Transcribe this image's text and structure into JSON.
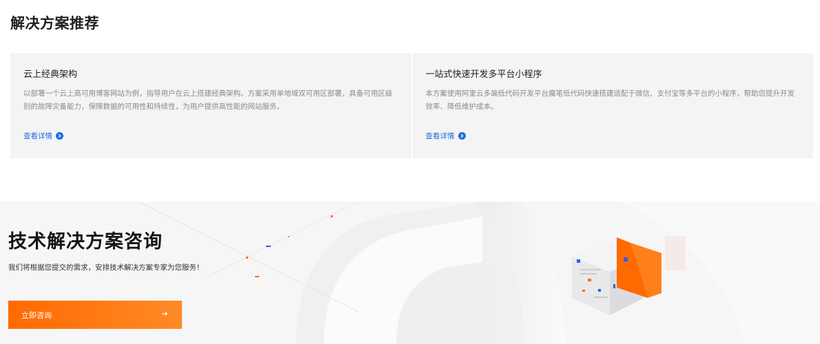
{
  "section": {
    "title": "解决方案推荐"
  },
  "cards": [
    {
      "title": "云上经典架构",
      "desc": "以部署一个云上高可用博客网站为例，指导用户在云上搭建经典架构。方案采用单地域双可用区部署，具备可用区级别的故障灾备能力，保障数据的可用性和持续性，为用户提供高性能的网站服务。",
      "link": "查看详情"
    },
    {
      "title": "一站式快速开发多平台小程序",
      "desc": "本方案使用阿里云多端低代码开发平台魔笔低代码快速搭建适配于微信、支付宝等多平台的小程序，帮助您提升开发效率、降低维护成本。",
      "link": "查看详情"
    }
  ],
  "banner": {
    "title": "技术解决方案咨询",
    "subtitle": "我们将根据您提交的需求，安排技术解决方案专家为您服务！",
    "cta": "立即咨询"
  },
  "colors": {
    "accent": "#ff6a00",
    "link": "#1f6ee0",
    "card_bg": "#f4f4f4"
  },
  "icons": {
    "link": "chevron-right-circle-icon",
    "cta": "arrow-right-icon"
  }
}
